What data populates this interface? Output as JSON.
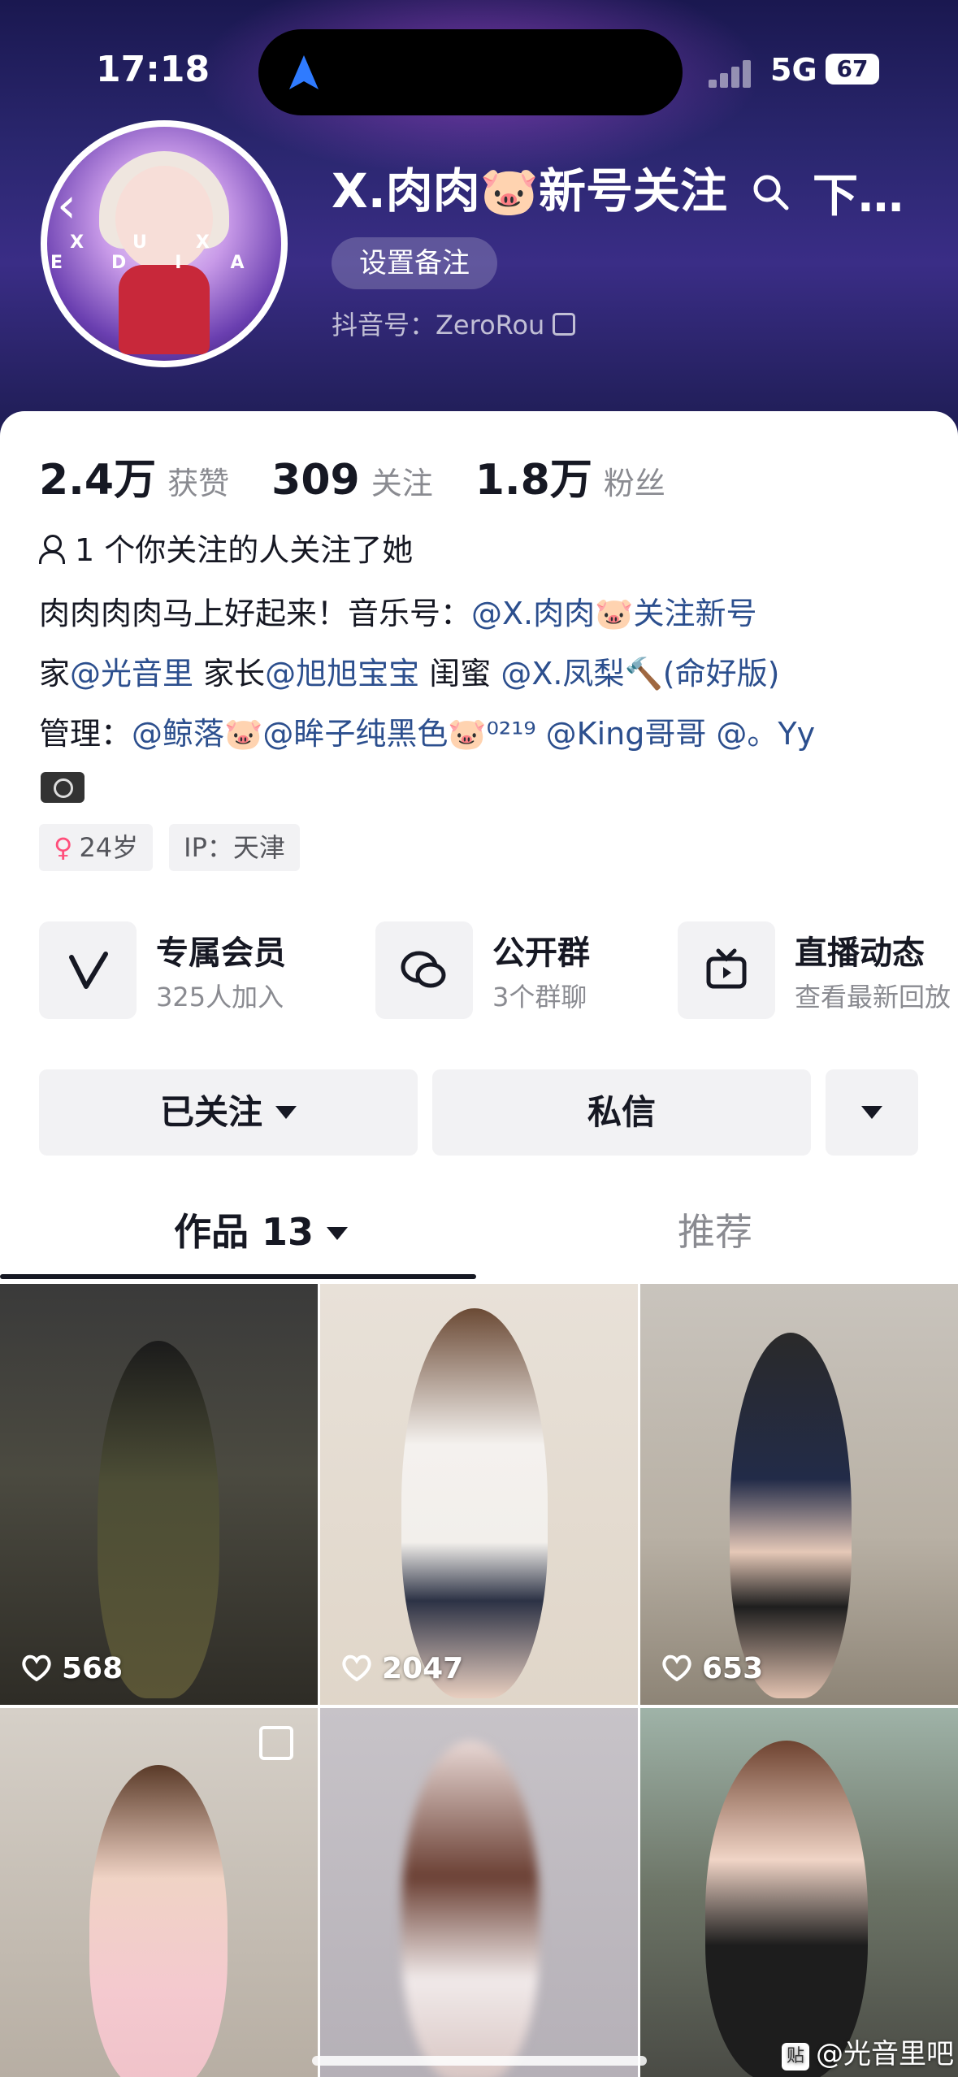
{
  "status_bar": {
    "time": "17:18",
    "network": "5G",
    "battery": "67"
  },
  "profile": {
    "nickname": "X.肉肉🐷新号关注",
    "remark_button": "设置备注",
    "douyin_id": "抖音号：ZeroRou",
    "avatar_text": "XUX EDIA"
  },
  "stats": [
    {
      "value": "2.4万",
      "label": "获赞"
    },
    {
      "value": "309",
      "label": "关注"
    },
    {
      "value": "1.8万",
      "label": "粉丝"
    }
  ],
  "mutual": "1 个你关注的人关注了她",
  "bio": {
    "line1_text": "肉肉肉肉马上好起来！音乐号：",
    "line1_link": "@X.肉肉🐷关注新号",
    "line2_a": "家",
    "line2_link1": "@光音里",
    "line2_b": "家长",
    "line2_link2": "@旭旭宝宝",
    "line2_c": "闺蜜",
    "line2_link3": "@X.凤梨🔨(命好版)",
    "line3_a": "管理：",
    "line3_link": "@鲸落🐷@眸子纯黑色🐷⁰²¹⁹ @King哥哥 @。Yy"
  },
  "tags": {
    "age": "24岁",
    "ip": "IP：天津"
  },
  "features": [
    {
      "title": "专属会员",
      "sub": "325人加入",
      "icon": "V"
    },
    {
      "title": "公开群",
      "sub": "3个群聊",
      "icon": "chat"
    },
    {
      "title": "直播动态",
      "sub": "查看最新回放",
      "icon": "tv"
    }
  ],
  "buttons": {
    "follow": "已关注",
    "message": "私信"
  },
  "tabs": {
    "works": "作品 13",
    "recommend": "推荐"
  },
  "posts": [
    {
      "likes": "568"
    },
    {
      "likes": "2047"
    },
    {
      "likes": "653"
    }
  ],
  "watermark": "@光音里吧",
  "colors": {
    "link": "#2c4f8e",
    "banner": "#2b2770",
    "tag_icon": "#ff4f7b"
  }
}
